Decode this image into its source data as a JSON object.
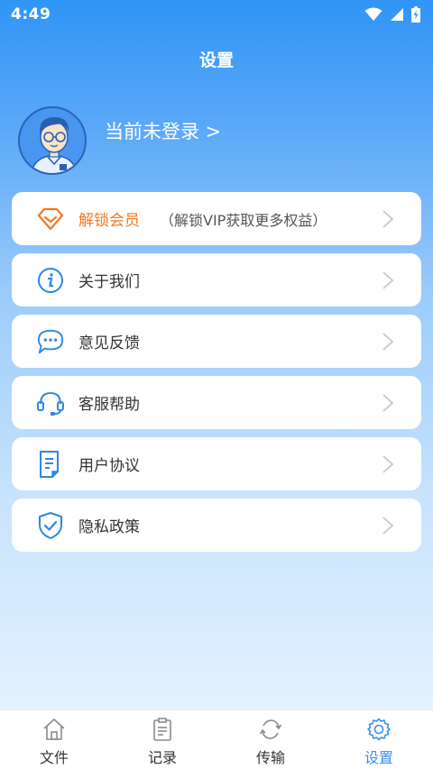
{
  "status_bar": {
    "time": "4:49"
  },
  "header": {
    "title": "设置"
  },
  "profile": {
    "login_text": "当前未登录 >"
  },
  "menu": {
    "items": [
      {
        "label": "解锁会员",
        "sub": "（解锁VIP获取更多权益）",
        "icon": "diamond-icon",
        "color": "#f07a22"
      },
      {
        "label": "关于我们",
        "icon": "info-icon",
        "color": "#2b88e6"
      },
      {
        "label": "意见反馈",
        "icon": "chat-bubble-icon",
        "color": "#2b88e6"
      },
      {
        "label": "客服帮助",
        "icon": "headset-icon",
        "color": "#2b88e6"
      },
      {
        "label": "用户协议",
        "icon": "document-icon",
        "color": "#2b88e6"
      },
      {
        "label": "隐私政策",
        "icon": "shield-check-icon",
        "color": "#2b88e6"
      }
    ]
  },
  "tabbar": {
    "active": "设置",
    "tabs": [
      {
        "label": "文件",
        "icon": "home-icon"
      },
      {
        "label": "记录",
        "icon": "clipboard-icon"
      },
      {
        "label": "传输",
        "icon": "sync-icon"
      },
      {
        "label": "设置",
        "icon": "gear-icon"
      }
    ]
  },
  "colors": {
    "accent": "#3a8ef0",
    "vip": "#f07a22",
    "header_gradient_top": "#2f95f6"
  }
}
